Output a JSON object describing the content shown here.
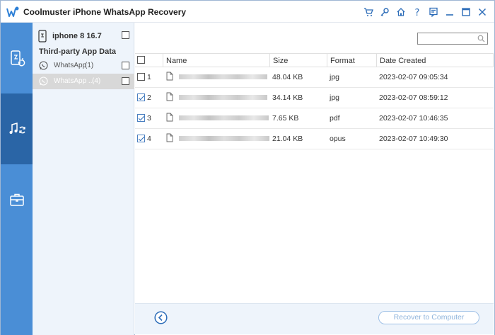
{
  "window": {
    "title": "Coolmuster iPhone WhatsApp Recovery",
    "titlebar_icons": [
      "cart-icon",
      "key-icon",
      "home-icon",
      "help-icon",
      "feedback-icon",
      "minimize-icon",
      "maximize-icon",
      "close-icon"
    ]
  },
  "nav": {
    "items": [
      {
        "icon": "phone-sync-icon",
        "active": false
      },
      {
        "icon": "music-sync-icon",
        "active": true
      },
      {
        "icon": "toolbox-icon",
        "active": false
      }
    ]
  },
  "device": {
    "name": "iphone 8 16.7",
    "section_title": "Third-party App Data",
    "apps": [
      {
        "label": "WhatsApp",
        "count": "(1)",
        "selected": false
      },
      {
        "label": "WhatsApp ...",
        "count": "(4)",
        "selected": true
      }
    ]
  },
  "search": {
    "placeholder": ""
  },
  "table": {
    "headers": {
      "name": "Name",
      "size": "Size",
      "format": "Format",
      "date": "Date Created"
    },
    "rows": [
      {
        "num": "1",
        "checked": false,
        "size": "48.04 KB",
        "format": "jpg",
        "date": "2023-02-07 09:05:34"
      },
      {
        "num": "2",
        "checked": true,
        "size": "34.14 KB",
        "format": "jpg",
        "date": "2023-02-07 08:59:12"
      },
      {
        "num": "3",
        "checked": true,
        "size": "7.65 KB",
        "format": "pdf",
        "date": "2023-02-07 10:46:35"
      },
      {
        "num": "4",
        "checked": true,
        "size": "21.04 KB",
        "format": "opus",
        "date": "2023-02-07 10:49:30"
      }
    ]
  },
  "footer": {
    "recover_label": "Recover to Computer"
  },
  "colors": {
    "nav_bg": "#4a8ed6",
    "nav_active": "#2a65a6",
    "panel_bg": "#eef4fb",
    "accent": "#2c6cb8"
  }
}
